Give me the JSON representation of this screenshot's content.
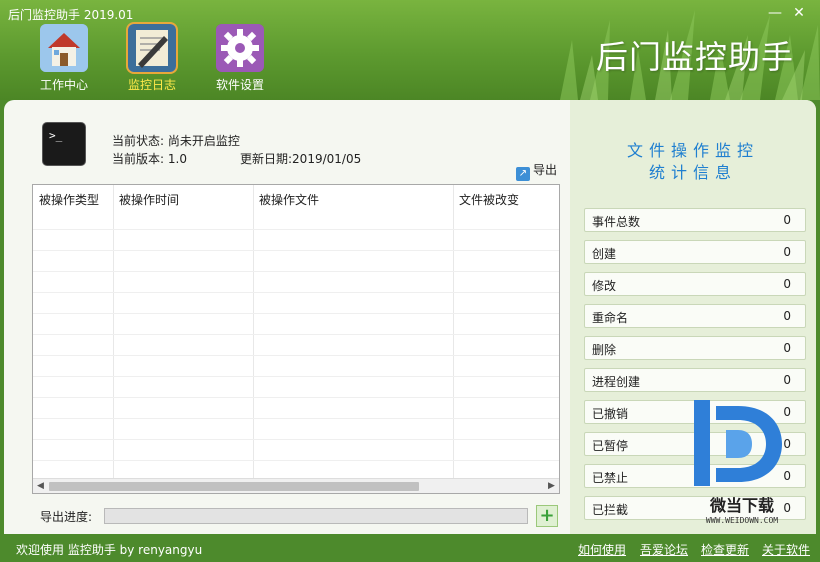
{
  "window": {
    "title": "后门监控助手 2019.01",
    "minimize": "—",
    "close": "✕"
  },
  "brand": "后门监控助手",
  "nav": [
    {
      "label": "工作中心",
      "icon": "house-icon",
      "active": false
    },
    {
      "label": "监控日志",
      "icon": "log-edit-icon",
      "active": true
    },
    {
      "label": "软件设置",
      "icon": "gear-icon",
      "active": false
    }
  ],
  "status": {
    "current_state_label": "当前状态:",
    "current_state_value": "尚未开启监控",
    "version_label": "当前版本:",
    "version_value": "1.0",
    "update_label": "更新日期:",
    "update_value": "2019/01/05"
  },
  "export_label": "导出",
  "table": {
    "columns": [
      "被操作类型",
      "被操作时间",
      "被操作文件",
      "文件被改变"
    ],
    "rows": []
  },
  "progress": {
    "label": "导出进度:",
    "value": 0,
    "add_symbol": "+"
  },
  "stats": {
    "title_line1": "文件操作监控",
    "title_line2": "统计信息",
    "items": [
      {
        "label": "事件总数",
        "value": "0"
      },
      {
        "label": "创建",
        "value": "0"
      },
      {
        "label": "修改",
        "value": "0"
      },
      {
        "label": "重命名",
        "value": "0"
      },
      {
        "label": "删除",
        "value": "0"
      },
      {
        "label": "进程创建",
        "value": "0"
      },
      {
        "label": "已撤销",
        "value": "0"
      },
      {
        "label": "已暂停",
        "value": "0"
      },
      {
        "label": "已禁止",
        "value": "0"
      },
      {
        "label": "已拦截",
        "value": "0"
      }
    ]
  },
  "footer": {
    "welcome": "欢迎使用 监控助手  by  renyangyu",
    "links": [
      "如何使用",
      "吾爱论坛",
      "检查更新",
      "关于软件"
    ]
  },
  "watermark": {
    "text": "微当下载",
    "url": "WWW.WEIDOWN.COM"
  },
  "colors": {
    "header_green": "#5d9a2f",
    "accent_blue": "#1f7fd0",
    "active_nav": "#ffe94a"
  }
}
